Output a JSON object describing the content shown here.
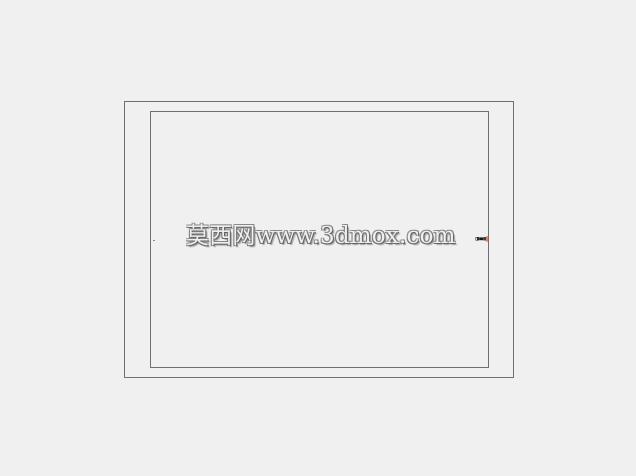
{
  "watermark": {
    "text": "莫西网www.3dmox.com"
  },
  "colors": {
    "background": "#f0f0f0",
    "frame_border": "#6f6f6f",
    "handle_accent": "#e46b2f"
  },
  "icons": {
    "right_handle": "connector-handle-icon"
  }
}
